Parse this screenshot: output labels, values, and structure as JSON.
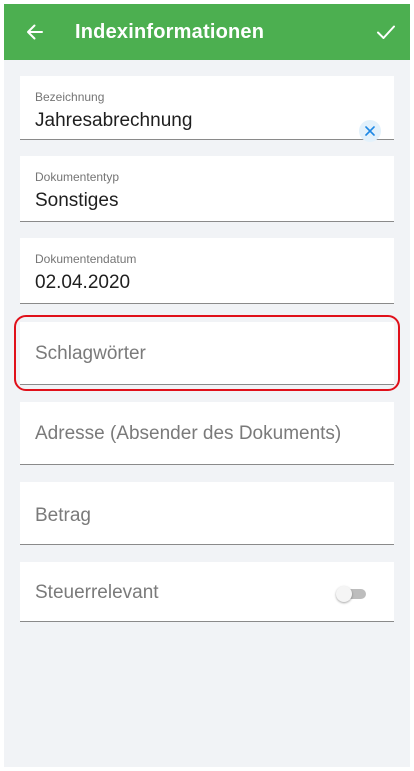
{
  "header": {
    "title": "Indexinformationen",
    "back_icon": "arrow-left-icon",
    "save_icon": "check-icon",
    "color": "#4caf50"
  },
  "form": {
    "bezeichnung": {
      "label": "Bezeichnung",
      "value": "Jahresabrechnung",
      "clear_icon": "close-icon"
    },
    "dokumententyp": {
      "label": "Dokumententyp",
      "value": "Sonstiges"
    },
    "dokumentendatum": {
      "label": "Dokumentendatum",
      "value": "02.04.2020"
    },
    "schlagwoerter": {
      "placeholder": "Schlagwörter",
      "highlighted": true
    },
    "adresse": {
      "placeholder": "Adresse (Absender des Dokuments)"
    },
    "betrag": {
      "placeholder": "Betrag"
    },
    "steuerrelevant": {
      "label": "Steuerrelevant",
      "toggle_on": false
    }
  },
  "colors": {
    "highlight": "#e0101a",
    "clear_button_bg": "#e3f1fb",
    "clear_button_icon": "#1e88e5"
  }
}
